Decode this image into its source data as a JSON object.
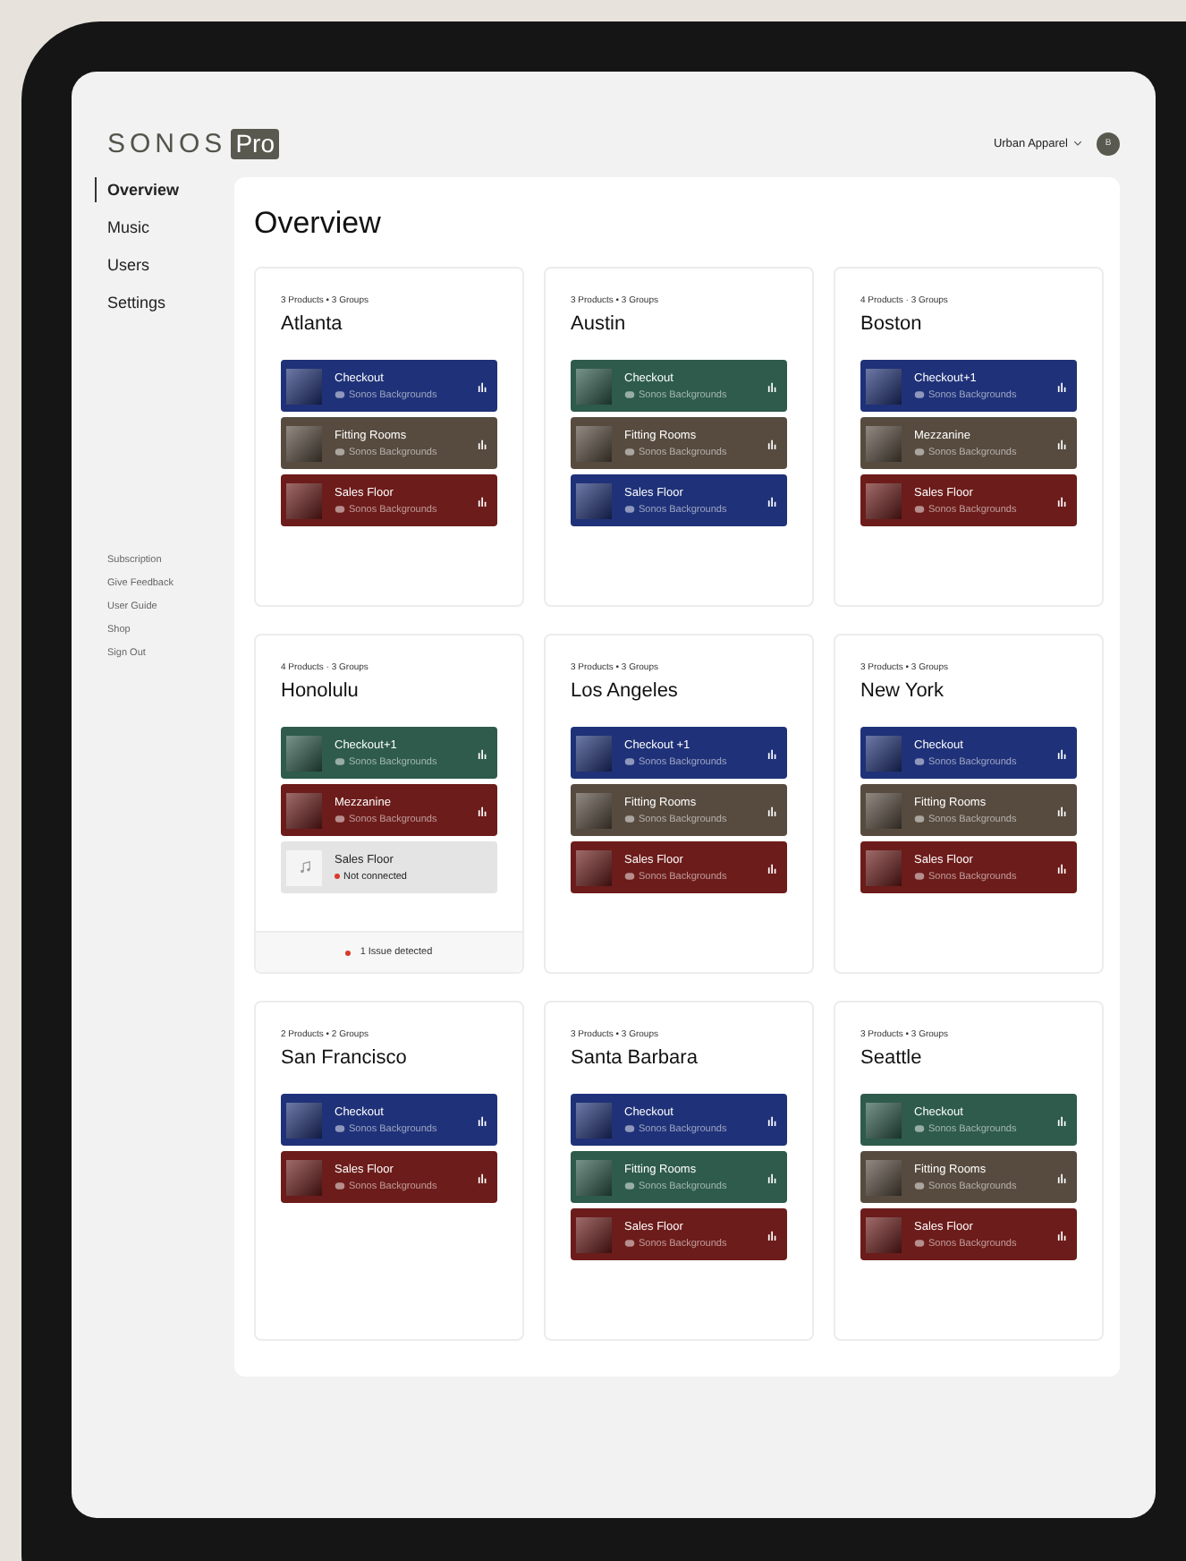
{
  "header": {
    "logo": "SONOS",
    "logo_badge": "Pro",
    "account": "Urban Apparel",
    "avatar": "B"
  },
  "nav": [
    {
      "label": "Overview",
      "selected": true
    },
    {
      "label": "Music",
      "selected": false
    },
    {
      "label": "Users",
      "selected": false
    },
    {
      "label": "Settings",
      "selected": false
    }
  ],
  "secondary_links": [
    "Subscription",
    "Give Feedback",
    "User Guide",
    "Shop",
    "Sign Out"
  ],
  "title": "Overview",
  "sites": [
    {
      "meta": "3 Products • 3 Groups",
      "name": "Atlanta",
      "groups": [
        {
          "kind": "playing",
          "name": "Checkout",
          "source": "Sonos Backgrounds",
          "color": "#1f3178"
        },
        {
          "kind": "playing",
          "name": "Fitting Rooms",
          "source": "Sonos Backgrounds",
          "color": "#574b3f"
        },
        {
          "kind": "playing",
          "name": "Sales Floor",
          "source": "Sonos Backgrounds",
          "color": "#6c1c1a"
        }
      ]
    },
    {
      "meta": "3 Products • 3 Groups",
      "name": "Austin",
      "groups": [
        {
          "kind": "playing",
          "name": "Checkout",
          "source": "Sonos Backgrounds",
          "color": "#2e5b4b"
        },
        {
          "kind": "playing",
          "name": "Fitting Rooms",
          "source": "Sonos Backgrounds",
          "color": "#574b3f"
        },
        {
          "kind": "playing",
          "name": "Sales Floor",
          "source": "Sonos Backgrounds",
          "color": "#1f3178"
        }
      ]
    },
    {
      "meta": "4 Products · 3 Groups",
      "name": "Boston",
      "groups": [
        {
          "kind": "playing",
          "name": "Checkout+1",
          "source": "Sonos Backgrounds",
          "color": "#1f3178"
        },
        {
          "kind": "playing",
          "name": "Mezzanine",
          "source": "Sonos Backgrounds",
          "color": "#574b3f"
        },
        {
          "kind": "playing",
          "name": "Sales Floor",
          "source": "Sonos Backgrounds",
          "color": "#6c1c1a"
        }
      ]
    },
    {
      "meta": "4 Products · 3 Groups",
      "name": "Honolulu",
      "groups": [
        {
          "kind": "playing",
          "name": "Checkout+1",
          "source": "Sonos Backgrounds",
          "color": "#2e5b4b"
        },
        {
          "kind": "playing",
          "name": "Mezzanine",
          "source": "Sonos Backgrounds",
          "color": "#6c1c1a"
        },
        {
          "kind": "offline",
          "name": "Sales Floor",
          "status": "Not connected"
        }
      ],
      "issue": "1 Issue detected"
    },
    {
      "meta": "3 Products • 3 Groups",
      "name": "Los Angeles",
      "groups": [
        {
          "kind": "playing",
          "name": "Checkout +1",
          "source": "Sonos Backgrounds",
          "color": "#1f3178"
        },
        {
          "kind": "playing",
          "name": "Fitting Rooms",
          "source": "Sonos Backgrounds",
          "color": "#574b3f"
        },
        {
          "kind": "playing",
          "name": "Sales Floor",
          "source": "Sonos Backgrounds",
          "color": "#6c1c1a"
        }
      ]
    },
    {
      "meta": "3 Products • 3 Groups",
      "name": "New York",
      "groups": [
        {
          "kind": "playing",
          "name": "Checkout",
          "source": "Sonos Backgrounds",
          "color": "#1f3178"
        },
        {
          "kind": "playing",
          "name": "Fitting Rooms",
          "source": "Sonos Backgrounds",
          "color": "#574b3f"
        },
        {
          "kind": "playing",
          "name": "Sales Floor",
          "source": "Sonos Backgrounds",
          "color": "#6c1c1a"
        }
      ]
    },
    {
      "meta": "2 Products • 2 Groups",
      "name": "San Francisco",
      "groups": [
        {
          "kind": "playing",
          "name": "Checkout",
          "source": "Sonos Backgrounds",
          "color": "#1f3178"
        },
        {
          "kind": "playing",
          "name": "Sales Floor",
          "source": "Sonos Backgrounds",
          "color": "#6c1c1a"
        }
      ]
    },
    {
      "meta": "3 Products • 3 Groups",
      "name": "Santa Barbara",
      "groups": [
        {
          "kind": "playing",
          "name": "Checkout",
          "source": "Sonos Backgrounds",
          "color": "#1f3178"
        },
        {
          "kind": "playing",
          "name": "Fitting Rooms",
          "source": "Sonos Backgrounds",
          "color": "#2e5b4b"
        },
        {
          "kind": "playing",
          "name": "Sales Floor",
          "source": "Sonos Backgrounds",
          "color": "#6c1c1a"
        }
      ]
    },
    {
      "meta": "3 Products • 3 Groups",
      "name": "Seattle",
      "groups": [
        {
          "kind": "playing",
          "name": "Checkout",
          "source": "Sonos Backgrounds",
          "color": "#2e5b4b"
        },
        {
          "kind": "playing",
          "name": "Fitting Rooms",
          "source": "Sonos Backgrounds",
          "color": "#574b3f"
        },
        {
          "kind": "playing",
          "name": "Sales Floor",
          "source": "Sonos Backgrounds",
          "color": "#6c1c1a"
        }
      ]
    }
  ]
}
